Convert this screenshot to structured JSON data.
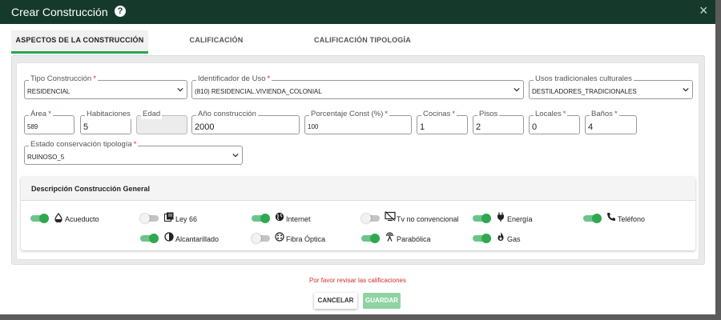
{
  "dialog": {
    "title": "Crear Construcción",
    "close_symbol": "×"
  },
  "tabs": [
    {
      "label": "ASPECTOS DE LA CONSTRUCCIÓN",
      "active": true
    },
    {
      "label": "CALIFICACIÓN",
      "active": false
    },
    {
      "label": "CALIFICACIÓN TIPOLOGÍA",
      "active": false
    }
  ],
  "form": {
    "tipo_construccion": {
      "label": "Tipo Construcción",
      "required": true,
      "value": "RESIDENCIAL"
    },
    "identificador_uso": {
      "label": "Identificador de Uso",
      "required": true,
      "value": "(810) RESIDENCIAL.VIVIENDA_COLONIAL"
    },
    "usos_tradicionales": {
      "label": "Usos tradicionales culturales",
      "required": false,
      "value": "DESTILADORES_TRADICIONALES"
    },
    "area": {
      "label": "Área",
      "required": true,
      "value": "589"
    },
    "habitaciones": {
      "label": "Habitaciones",
      "required": false,
      "value": "5"
    },
    "edad": {
      "label": "Edad",
      "required": false,
      "value": ""
    },
    "anio_construccion": {
      "label": "Año construcción",
      "required": false,
      "value": "2000"
    },
    "porcentaje_const": {
      "label": "Porcentaje Const (%)",
      "required": true,
      "value": "100"
    },
    "cocinas": {
      "label": "Cocinas",
      "required": true,
      "value": "1"
    },
    "pisos": {
      "label": "Pisos",
      "required": false,
      "value": "2"
    },
    "locales": {
      "label": "Locales",
      "required": true,
      "value": "0"
    },
    "banos": {
      "label": "Baños",
      "required": true,
      "value": "4"
    },
    "estado_conservacion": {
      "label": "Estado conservación tipología",
      "required": true,
      "value": "RUINOSO_5"
    }
  },
  "required_marker": "*",
  "description": {
    "title": "Descripción Construcción General",
    "services": [
      {
        "label": "Acueducto",
        "icon": "drop-icon",
        "enabled": true
      },
      {
        "label": "Ley 66",
        "icon": "library-books-icon",
        "enabled": false
      },
      {
        "label": "Internet",
        "icon": "globe-icon",
        "enabled": true
      },
      {
        "label": "Tv no convencional",
        "icon": "tv-off-icon",
        "enabled": false
      },
      {
        "label": "Energía",
        "icon": "power-plug-icon",
        "enabled": true
      },
      {
        "label": "Teléfono",
        "icon": "phone-icon",
        "enabled": true
      },
      {
        "label": "Alcantarillado",
        "icon": "contrast-icon",
        "enabled": true
      },
      {
        "label": "Fibra Óptica",
        "icon": "fiber-icon",
        "enabled": false
      },
      {
        "label": "Parabólica",
        "icon": "antenna-icon",
        "enabled": true
      },
      {
        "label": "Gas",
        "icon": "flame-icon",
        "enabled": true
      }
    ]
  },
  "warning": "Por favor revisar las calificaciones",
  "buttons": {
    "cancel": "CANCELAR",
    "save": "GUARDAR"
  },
  "colors": {
    "header": "#153a2b",
    "accent": "#27a550",
    "required": "#d32f2f",
    "save_disabled": "#8fd3a3"
  }
}
